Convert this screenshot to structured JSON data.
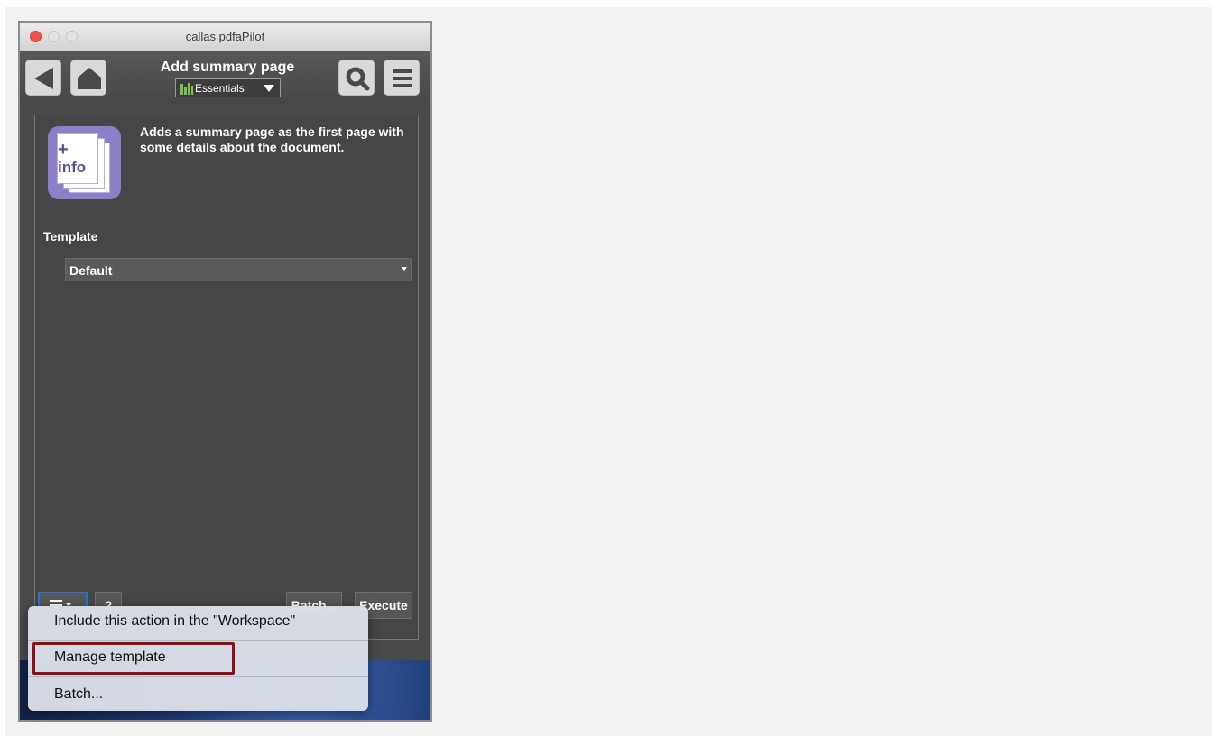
{
  "window": {
    "title": "callas pdfaPilot"
  },
  "toolbar": {
    "back_icon": "triangle-left-icon",
    "home_icon": "house-icon",
    "title": "Add summary page",
    "set_label": "Essentials",
    "set_icon": "green-bars-icon",
    "search_icon": "magnifier-icon",
    "menu_icon": "hamburger-icon"
  },
  "panel": {
    "tool_icon_plus": "+",
    "tool_icon_text": "info",
    "description": "Adds a summary page as the first page with some details about the document.",
    "template_label": "Template",
    "template_value": "Default",
    "menu_button_icon": "list-menu-icon",
    "help_label": "?",
    "batch_label": "Batch...",
    "execute_label": "Execute"
  },
  "popup": {
    "items": [
      {
        "label": "Include this action in the \"Workspace\""
      },
      {
        "label": "Manage template"
      },
      {
        "label": "Batch..."
      }
    ],
    "highlight_color": "#8f0d13"
  },
  "colors": {
    "window_bg": "#4a4a4a",
    "accent_blue": "#2f6fd9",
    "set_green": "#7cc243",
    "icon_purple": "#8d7fc7"
  }
}
